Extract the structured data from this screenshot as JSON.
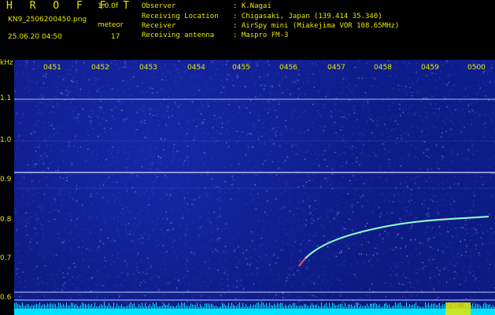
{
  "header": {
    "app_title": "H R O F F T",
    "version": "1.0.0f",
    "filename": "KN9_2506200450.png",
    "meteor_label": "meteor",
    "datetime": "25.06.20 04:50",
    "meteor_count": "17",
    "info": [
      {
        "key": "Observer",
        "value": ": K.Nagai"
      },
      {
        "key": "Receiving Location",
        "value": ": Chigasaki, Japan (139.414 35.340)"
      },
      {
        "key": "Receiver",
        "value": ": AirSpy mini (Miakejima VOR 108.65MHz)"
      },
      {
        "key": "Receiving antenna",
        "value": ": Maspro FM-3"
      }
    ]
  },
  "axes": {
    "y_unit": "kHz",
    "y_ticks": [
      "1.1",
      "1.0",
      "0.9",
      "0.8",
      "0.7",
      "0.6"
    ],
    "x_ticks": [
      "0451",
      "0452",
      "0453",
      "0454",
      "0455",
      "0456",
      "0457",
      "0458",
      "0459",
      "0500"
    ]
  },
  "colors": {
    "background": "#0c1a80",
    "text": "#e6e600",
    "line": "#d8dcff",
    "trace": "#7fffd4",
    "noise_floor": "#00e5ff"
  }
}
